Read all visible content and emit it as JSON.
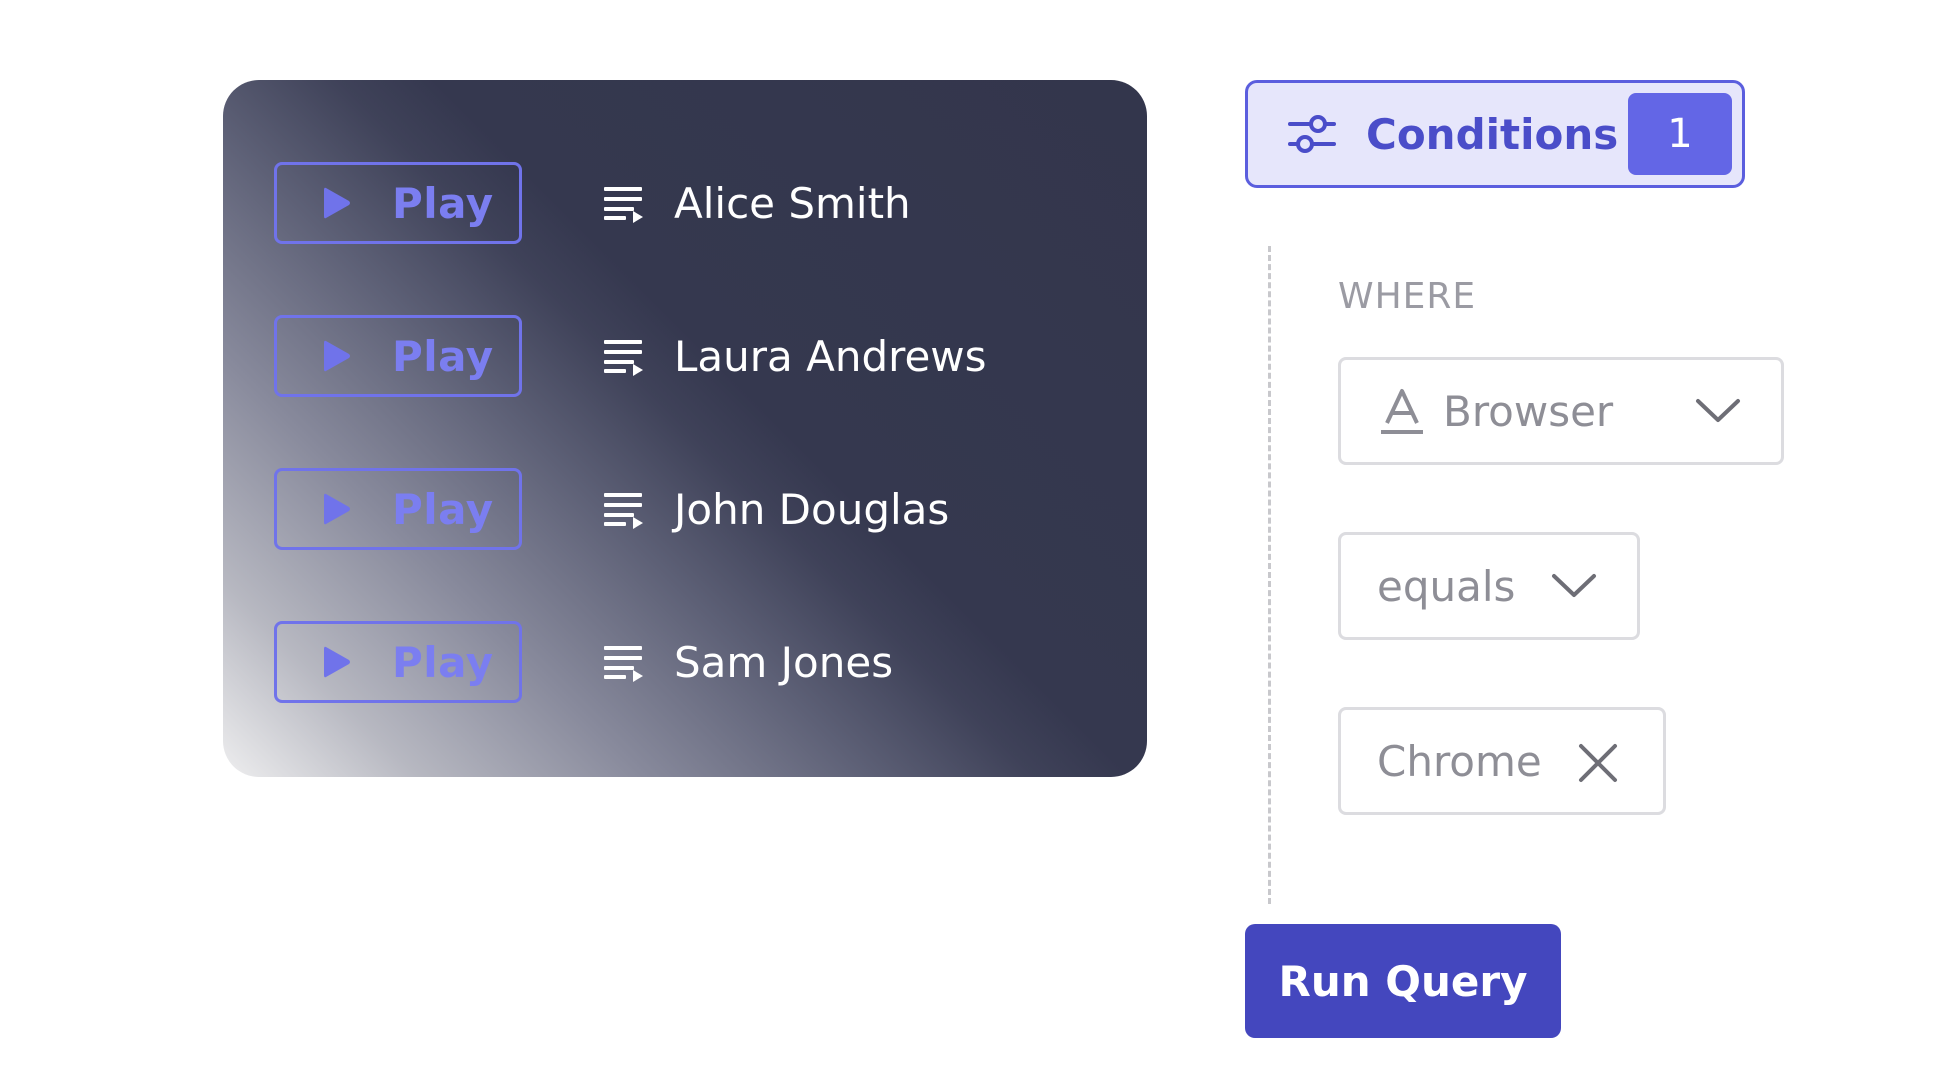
{
  "sessions": [
    {
      "play_label": "Play",
      "name": "Alice Smith"
    },
    {
      "play_label": "Play",
      "name": "Laura Andrews"
    },
    {
      "play_label": "Play",
      "name": "John Douglas"
    },
    {
      "play_label": "Play",
      "name": "Sam Jones"
    }
  ],
  "conditions": {
    "toggle_label": "Conditions",
    "count": "1",
    "where_label": "WHERE",
    "property": {
      "value": "Browser",
      "icon": "text-type-icon"
    },
    "operator": {
      "value": "equals"
    },
    "value_chip": {
      "value": "Chrome",
      "icon": "close-icon"
    }
  },
  "actions": {
    "run_label": "Run Query"
  },
  "colors": {
    "accent": "#7073ea",
    "badge": "#6366e6",
    "primary_button": "#4447be",
    "card_dark": "#33364c"
  }
}
